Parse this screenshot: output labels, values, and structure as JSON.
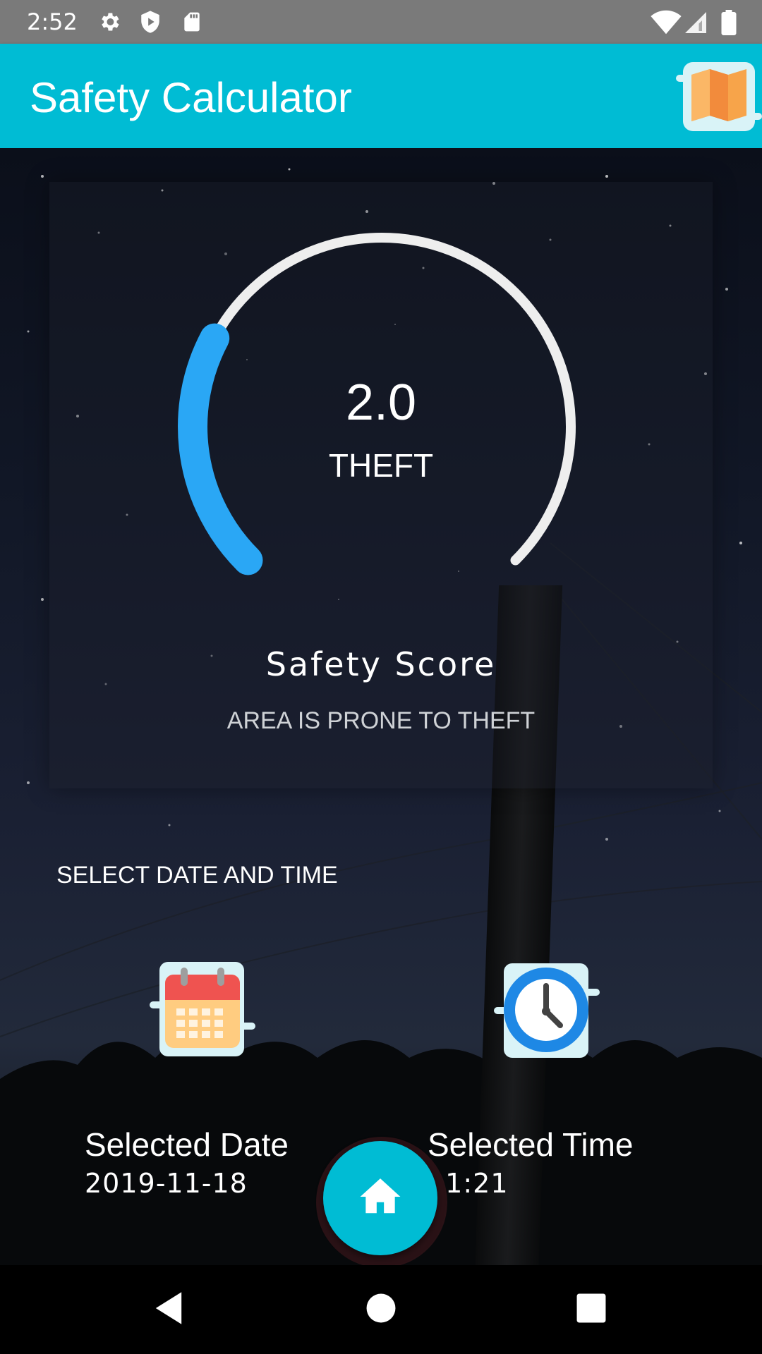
{
  "status_bar": {
    "time": "2:52",
    "icons": [
      "gear-icon",
      "shield-play-icon",
      "sd-card-icon",
      "wifi-icon",
      "signal-icon",
      "battery-icon"
    ]
  },
  "app_bar": {
    "title": "Safety Calculator",
    "action_icon": "map-icon",
    "color": "#00bcd4"
  },
  "gauge": {
    "value": "2.0",
    "label": "THEFT",
    "progress_fraction": 0.27,
    "progress_color": "#2aa7f5",
    "track_color": "#eeeeee"
  },
  "safety": {
    "title": "Safety Score",
    "subtitle": "AREA IS PRONE TO THEFT"
  },
  "date_time": {
    "heading": "SELECT DATE AND TIME",
    "date_title": "Selected Date",
    "date_value": "2019-11-18",
    "time_title": "Selected Time",
    "time_value": "11:21"
  },
  "fab": {
    "icon": "home-icon",
    "color": "#00bcd4"
  },
  "nav_bar": {
    "icons": [
      "back-icon",
      "home-circle-icon",
      "recents-icon"
    ]
  }
}
